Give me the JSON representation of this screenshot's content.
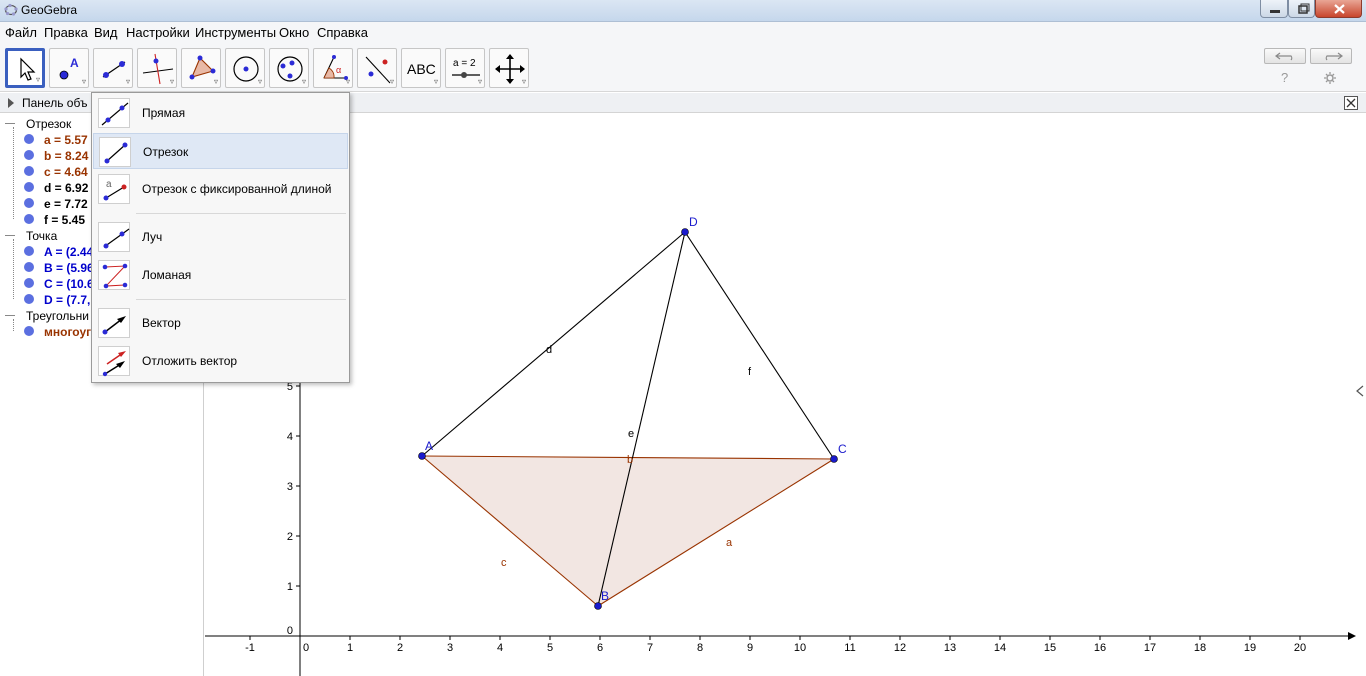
{
  "window": {
    "title": "GeoGebra"
  },
  "menu": [
    "Файл",
    "Правка",
    "Вид",
    "Настройки",
    "Инструменты",
    "Окно",
    "Справка"
  ],
  "toolbar": {
    "abc_label": "ABC",
    "slider_label": "a = 2",
    "help_symbol": "?"
  },
  "algebra": {
    "header": "Панель объ",
    "categories": {
      "segment": "Отрезок",
      "point": "Точка",
      "triangle": "Треугольни"
    },
    "segments": [
      {
        "label": "a = 5.57",
        "color": "#993300"
      },
      {
        "label": "b = 8.24",
        "color": "#993300"
      },
      {
        "label": "c = 4.64",
        "color": "#993300"
      },
      {
        "label": "d = 6.92",
        "color": "#000000"
      },
      {
        "label": "e = 7.72",
        "color": "#000000"
      },
      {
        "label": "f = 5.45",
        "color": "#000000"
      }
    ],
    "points": [
      {
        "label": "A = (2.44",
        "color": "#0000cc"
      },
      {
        "label": "B = (5.96",
        "color": "#0000cc"
      },
      {
        "label": "C = (10.6",
        "color": "#0000cc"
      },
      {
        "label": "D = (7.7,",
        "color": "#0000cc"
      }
    ],
    "polygons": [
      {
        "label": "многоуг",
        "color": "#993300"
      }
    ]
  },
  "popup_menu": {
    "items": [
      {
        "label": "Прямая",
        "icon": "line-icon"
      },
      {
        "label": "Отрезок",
        "icon": "segment-icon"
      },
      {
        "label": "Отрезок с фиксированной длиной",
        "icon": "fixed-segment-icon"
      },
      {
        "label": "Луч",
        "icon": "ray-icon"
      },
      {
        "label": "Ломаная",
        "icon": "polyline-icon"
      },
      {
        "label": "Вектор",
        "icon": "vector-icon"
      },
      {
        "label": "Отложить вектор",
        "icon": "vector-from-point-icon"
      }
    ],
    "selected_index": 1
  },
  "graphics": {
    "x_ticks": [
      "-1",
      "0",
      "1",
      "2",
      "3",
      "4",
      "5",
      "6",
      "7",
      "8",
      "9",
      "10",
      "11",
      "12",
      "13",
      "14",
      "15",
      "16",
      "17",
      "18",
      "19",
      "20"
    ],
    "y_ticks": [
      "0",
      "1",
      "2",
      "3",
      "4",
      "5"
    ],
    "points": [
      {
        "name": "A",
        "x": 2.44,
        "y": 3.6
      },
      {
        "name": "B",
        "x": 5.96,
        "y": 0.6
      },
      {
        "name": "C",
        "x": 10.68,
        "y": 3.54
      },
      {
        "name": "D",
        "x": 7.7,
        "y": 8.08
      }
    ],
    "segment_labels": {
      "a": "a",
      "b": "b",
      "c": "c",
      "d": "d",
      "e": "e",
      "f": "f"
    },
    "colors": {
      "polygon_fill": "#f2e6e2",
      "polygon_stroke": "#993300",
      "line": "#000000",
      "point": "#1a1acc",
      "point_label": "#1a1acc",
      "polygon_label": "#993300"
    }
  }
}
